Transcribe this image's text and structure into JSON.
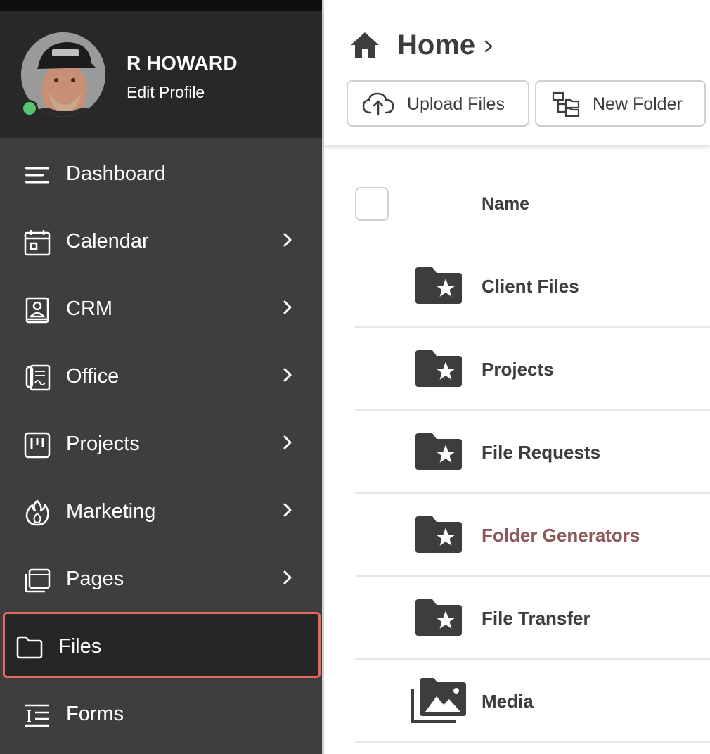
{
  "profile": {
    "name": "R HOWARD",
    "edit_label": "Edit Profile",
    "status": "online"
  },
  "sidebar": {
    "items": [
      {
        "label": "Dashboard",
        "icon": "menu-icon",
        "has_submenu": false
      },
      {
        "label": "Calendar",
        "icon": "calendar-icon",
        "has_submenu": true
      },
      {
        "label": "CRM",
        "icon": "contact-book-icon",
        "has_submenu": true
      },
      {
        "label": "Office",
        "icon": "office-document-icon",
        "has_submenu": true
      },
      {
        "label": "Projects",
        "icon": "kanban-icon",
        "has_submenu": true
      },
      {
        "label": "Marketing",
        "icon": "flame-icon",
        "has_submenu": true
      },
      {
        "label": "Pages",
        "icon": "pages-icon",
        "has_submenu": true
      },
      {
        "label": "Files",
        "icon": "folder-icon",
        "has_submenu": false,
        "active": true
      },
      {
        "label": "Forms",
        "icon": "form-icon",
        "has_submenu": false
      }
    ]
  },
  "header": {
    "breadcrumb": "Home",
    "upload_label": "Upload Files",
    "new_folder_label": "New Folder"
  },
  "file_list": {
    "column_name": "Name",
    "rows": [
      {
        "label": "Client Files",
        "icon": "starred-folder-icon"
      },
      {
        "label": "Projects",
        "icon": "starred-folder-icon"
      },
      {
        "label": "File Requests",
        "icon": "starred-folder-icon"
      },
      {
        "label": "Folder Generators",
        "icon": "starred-folder-icon",
        "highlight": true
      },
      {
        "label": "File Transfer",
        "icon": "starred-folder-icon"
      },
      {
        "label": "Media",
        "icon": "media-library-icon"
      }
    ]
  },
  "colors": {
    "sidebar_bg": "#3e3e3e",
    "profile_bg": "#282828",
    "active_border": "#e56a5c",
    "status_online": "#57c46e",
    "text_dark": "#3d3d3d",
    "link_highlight": "#8b5a58"
  }
}
